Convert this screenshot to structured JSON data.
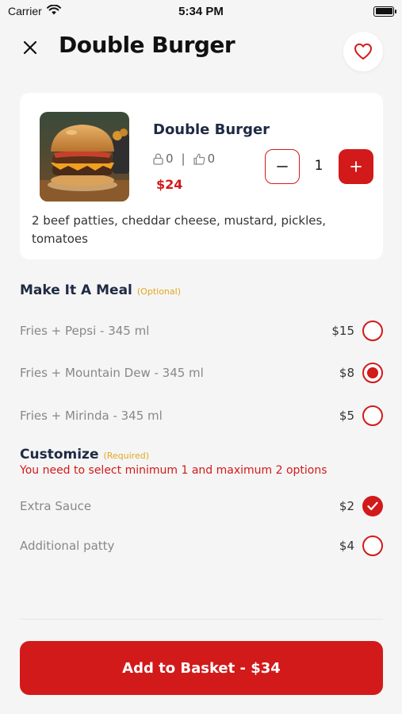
{
  "status_bar": {
    "carrier": "Carrier",
    "time": "5:34 PM"
  },
  "header": {
    "title": "Double Burger"
  },
  "product": {
    "name": "Double Burger",
    "locks_count": "0",
    "likes_count": "0",
    "stat_separator": "|",
    "price": "$24",
    "quantity": "1",
    "description": "2 beef patties, cheddar cheese, mustard, pickles, tomatoes"
  },
  "meal": {
    "title": "Make It A Meal",
    "tag": "(Optional)",
    "options": [
      {
        "label": "Fries + Pepsi - 345 ml",
        "price": "$15",
        "selected": false
      },
      {
        "label": "Fries + Mountain Dew - 345 ml",
        "price": "$8",
        "selected": true
      },
      {
        "label": "Fries + Mirinda - 345 ml",
        "price": "$5",
        "selected": false
      }
    ]
  },
  "customize": {
    "title": "Customize",
    "tag": "(Required)",
    "note": "You need to select minimum 1 and maximum 2 options",
    "options": [
      {
        "label": "Extra Sauce",
        "price": "$2",
        "checked": true
      },
      {
        "label": "Additional patty",
        "price": "$4",
        "checked": false
      }
    ]
  },
  "footer": {
    "button_label": "Add to Basket - $34"
  },
  "colors": {
    "accent": "#d21a1a",
    "optional_tag": "#e0a81e",
    "title": "#1f2a44"
  }
}
